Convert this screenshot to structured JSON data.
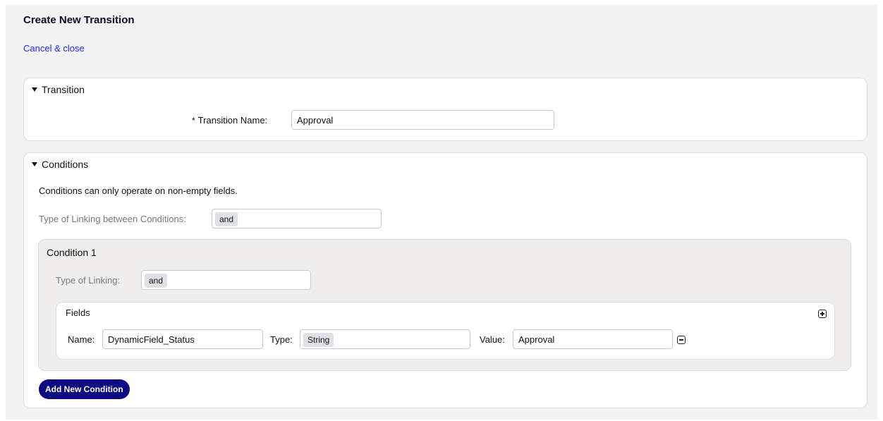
{
  "page": {
    "title": "Create New Transition",
    "cancel_link": "Cancel & close"
  },
  "transition_section": {
    "header": "Transition",
    "required_marker": "*",
    "name_label": "Transition Name:",
    "name_value": "Approval"
  },
  "conditions_section": {
    "header": "Conditions",
    "note": "Conditions can only operate on non-empty fields.",
    "linking_label": "Type of Linking between Conditions:",
    "linking_value": "and",
    "conditions": [
      {
        "title": "Condition 1",
        "linking_label": "Type of Linking:",
        "linking_value": "and",
        "fields": {
          "title": "Fields",
          "rows": [
            {
              "name_label": "Name:",
              "name_value": "DynamicField_Status",
              "type_label": "Type:",
              "type_value": "String",
              "value_label": "Value:",
              "value_value": "Approval"
            }
          ]
        }
      }
    ],
    "add_button": "Add New Condition"
  },
  "icons": {
    "collapse": "triangle-down-icon",
    "add_field": "plus-square-icon",
    "remove_field": "minus-square-icon"
  },
  "colors": {
    "link": "#1a2aff",
    "primary_button": "#0c0b82",
    "page_background": "#f2f2f3",
    "condition_background": "#efeeec"
  }
}
